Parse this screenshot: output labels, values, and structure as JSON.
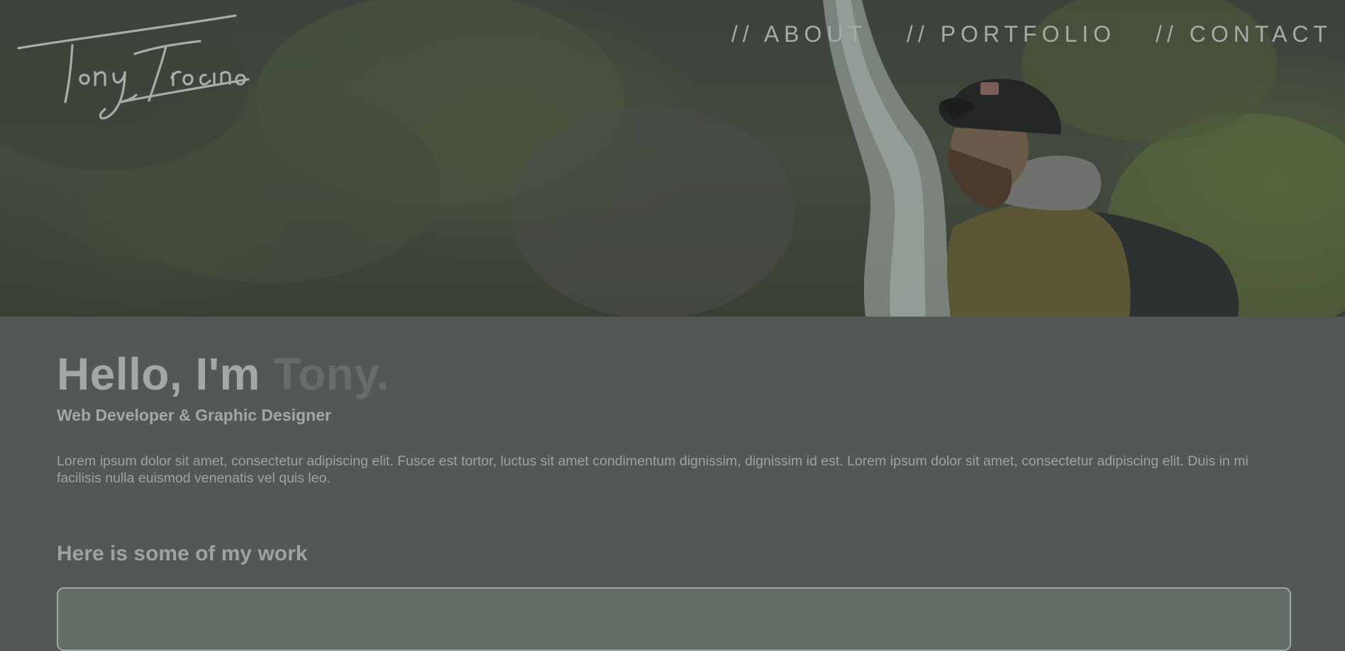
{
  "site": {
    "logo_text": "Tony Trocino"
  },
  "nav": {
    "items": [
      {
        "label": "// ABOUT"
      },
      {
        "label": "// PORTFOLIO"
      },
      {
        "label": "// CONTACT"
      }
    ]
  },
  "intro": {
    "greeting": "Hello, I'm ",
    "name": "Tony.",
    "subtitle": "Web Developer & Graphic Designer",
    "body": "Lorem ipsum dolor sit amet, consectetur adipiscing elit. Fusce est tortor, luctus sit amet condimentum dignissim, dignissim id est. Lorem ipsum dolor sit amet, consectetur adipiscing elit. Duis in mi facilisis nulla euismod venenatis vel quis leo."
  },
  "work": {
    "heading": "Here is some of my work"
  },
  "colors": {
    "background": "#525854",
    "text": "#a3a8a4",
    "name_accent": "#666c68",
    "card": "#626d65"
  }
}
